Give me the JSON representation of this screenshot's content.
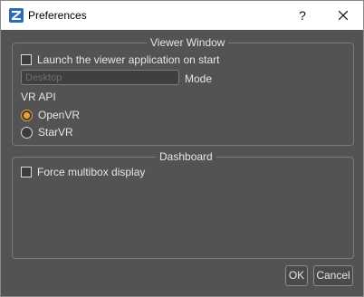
{
  "window": {
    "title": "Preferences",
    "help_label": "?",
    "app_icon": "z-logo-icon",
    "close_icon": "close-icon"
  },
  "viewer_window": {
    "title": "Viewer Window",
    "launch_label": "Launch the viewer application on start",
    "launch_checked": false,
    "mode_value": "Desktop",
    "mode_label": "Mode",
    "vr_api_label": "VR API",
    "vr_options": [
      {
        "label": "OpenVR",
        "checked": true
      },
      {
        "label": "StarVR",
        "checked": false
      }
    ]
  },
  "dashboard": {
    "title": "Dashboard",
    "multibox_label": "Force multibox display",
    "multibox_checked": false
  },
  "buttons": {
    "ok_label": "OK",
    "cancel_label": "Cancel"
  },
  "colors": {
    "background": "#535353",
    "accent": "#f0a030"
  }
}
